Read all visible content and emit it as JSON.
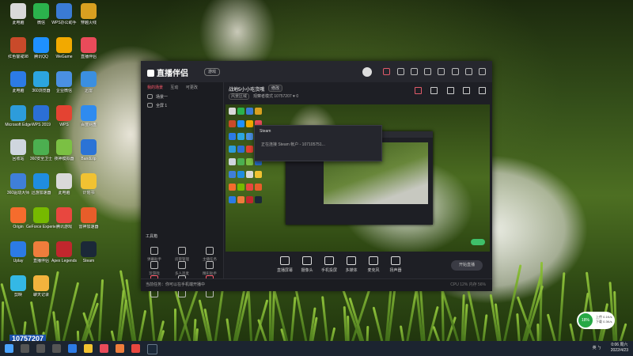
{
  "desktop": {
    "icons": [
      {
        "label": "此电脑",
        "color": "#d9d9d9"
      },
      {
        "label": "微信",
        "color": "#2bb24c"
      },
      {
        "label": "WPS办公助手",
        "color": "#3a7bd5"
      },
      {
        "label": "穿越火线",
        "color": "#d8a020"
      },
      {
        "label": "红色警戒98",
        "color": "#c94a2a"
      },
      {
        "label": "腾讯QQ",
        "color": "#1e90ff"
      },
      {
        "label": "WeGame",
        "color": "#f2a900"
      },
      {
        "label": "直播伴侣",
        "color": "#e94b5a"
      },
      {
        "label": "此电脑",
        "color": "#2c7be5"
      },
      {
        "label": "360浏览器",
        "color": "#2ca5e0"
      },
      {
        "label": "企业微信",
        "color": "#4a90e2"
      },
      {
        "label": "迅雷",
        "color": "#3b8fe0"
      },
      {
        "label": "Microsoft Edge",
        "color": "#2d9cdb"
      },
      {
        "label": "WPS 2019",
        "color": "#2b6fd6"
      },
      {
        "label": "WPS",
        "color": "#e44332"
      },
      {
        "label": "百度网盘",
        "color": "#2f8bef"
      },
      {
        "label": "回收站",
        "color": "#cfd6de"
      },
      {
        "label": "360安全卫士",
        "color": "#4caf50"
      },
      {
        "label": "夜神模拟器",
        "color": "#7bc043"
      },
      {
        "label": "Bandizip",
        "color": "#2b73d6"
      },
      {
        "label": "360驱动大师",
        "color": "#3f7fd9"
      },
      {
        "label": "迅游加速器",
        "color": "#1f8de0"
      },
      {
        "label": "此电脑",
        "color": "#d9d9d9"
      },
      {
        "label": "计划书",
        "color": "#f1c232"
      },
      {
        "label": "Origin",
        "color": "#f56c2d"
      },
      {
        "label": "GeForce Experience",
        "color": "#76b900"
      },
      {
        "label": "腾讯游戏",
        "color": "#e8473f"
      },
      {
        "label": "雷神加速器",
        "color": "#e85d2a"
      },
      {
        "label": "Uplay",
        "color": "#2c7be5"
      },
      {
        "label": "直播伴侣",
        "color": "#ef7d3c"
      },
      {
        "label": "Apex Legends",
        "color": "#c1272d"
      },
      {
        "label": "Steam",
        "color": "#1b2838"
      },
      {
        "label": "剪映",
        "color": "#34b8e5"
      },
      {
        "label": "聊天记录",
        "color": "#f3b33d"
      }
    ],
    "stream_id": "10757207",
    "widget": {
      "percent": "18%",
      "line1": "上传 0.1K/s",
      "line2": "下载 0.3K/s"
    }
  },
  "window": {
    "app_name": "直播伴侣",
    "badge": "游戏",
    "sidebar_tabs": [
      "我的场景",
      "互动",
      "可更改"
    ],
    "scenes": [
      "场景一",
      "全屏 1"
    ],
    "tools_header": "工具箱",
    "tools": [
      {
        "label": "弹幕助手",
        "red": false
      },
      {
        "label": "房管管理",
        "red": false
      },
      {
        "label": "主播任务",
        "red": false
      },
      {
        "label": "玩游戏",
        "red": false
      },
      {
        "label": "多人连麦",
        "red": false
      },
      {
        "label": "精彩助手",
        "red": false
      },
      {
        "label": "语音直播",
        "red": true
      },
      {
        "label": "高级设置",
        "red": false
      },
      {
        "label": "弹幕库",
        "red": true
      },
      {
        "label": "",
        "red": false
      },
      {
        "label": "",
        "red": false
      },
      {
        "label": "",
        "red": false
      }
    ],
    "room_title": "战地5小小吃货哦",
    "room_tag": "修改",
    "meta_pill": "风景区域",
    "meta_text": "观察者模式  10757207",
    "meta_likes": "0",
    "tooltip_title": "Steam",
    "tooltip_text": "正在连接 Steam 帐户 - 107105751...",
    "controls": [
      "直播屏幕",
      "摄像头",
      "手机投屏",
      "多媒体",
      "麦克风",
      "扬声器"
    ],
    "live_button": "开始直播",
    "status_text": "当前任务：你可以在手机端开播中",
    "status_right": "CPU 12%  内存 56%"
  },
  "taskbar": {
    "tray": "英  ㄅ",
    "time": "0:06 周六",
    "date": "2022/4/23"
  }
}
